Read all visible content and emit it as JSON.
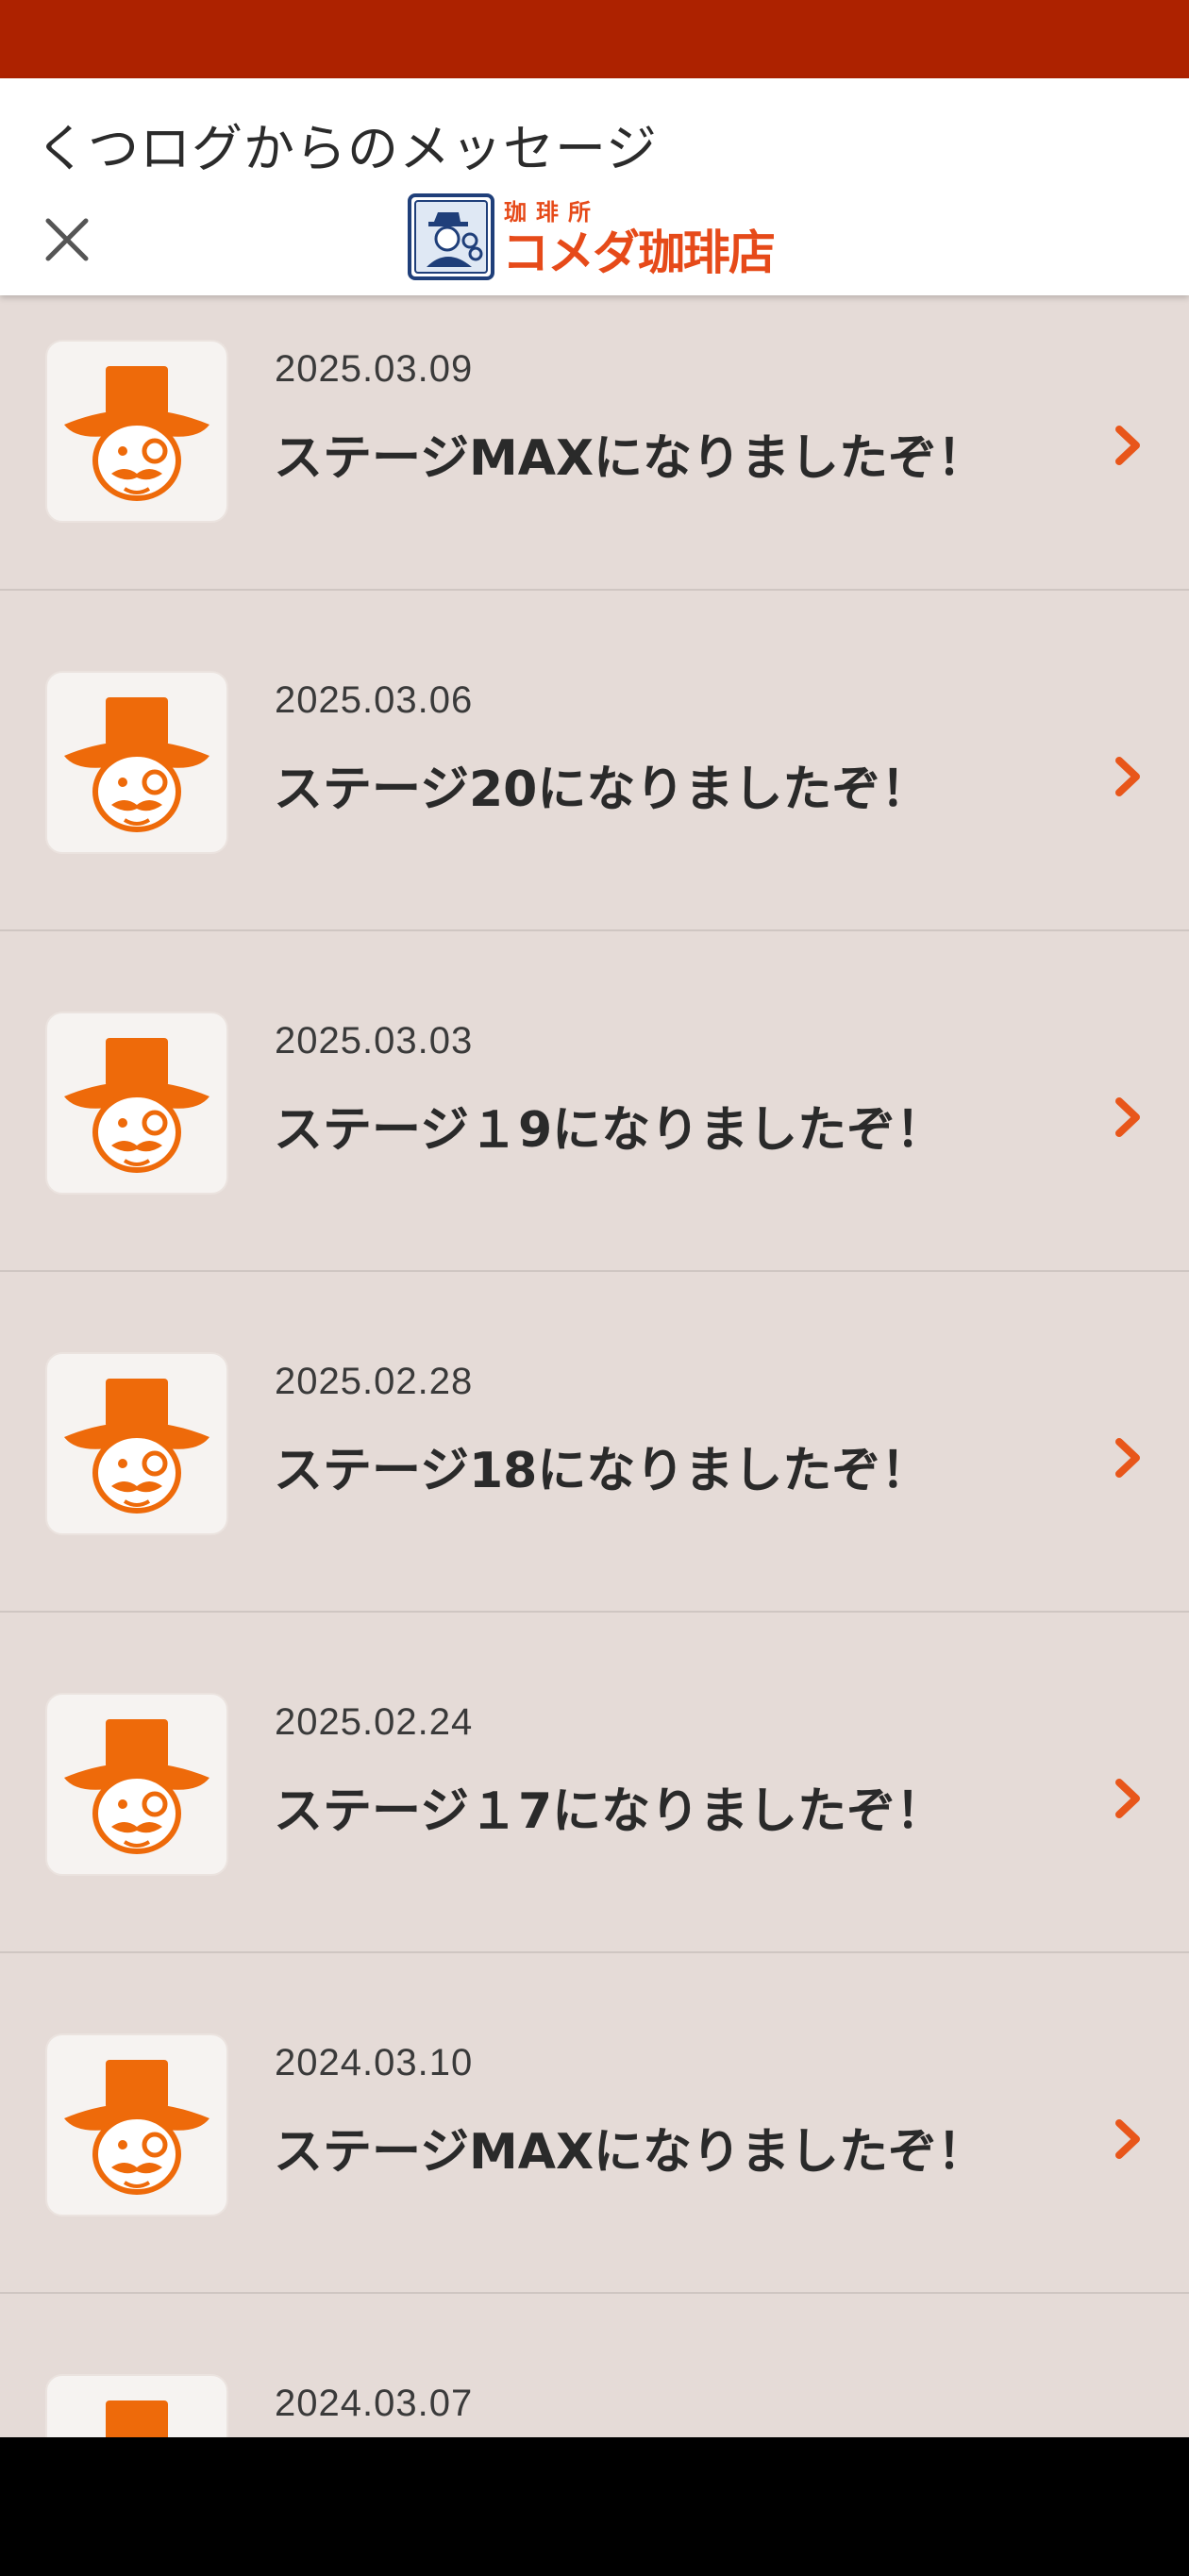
{
  "header": {
    "title": "くつログからのメッセージ",
    "close_icon": "close-icon",
    "logo": {
      "label": "珈琲所 コメダ珈琲店",
      "small_text": "珈琲所",
      "main_text": "コメダ珈琲店",
      "accent_color": "#e64a19"
    }
  },
  "colors": {
    "status_bar": "#ad2200",
    "list_background": "#e5dbd7",
    "accent": "#e8561a"
  },
  "messages": [
    {
      "date": "2025.03.09",
      "text": "ステージMAXになりましたぞ！",
      "icon": "mascot-icon"
    },
    {
      "date": "2025.03.06",
      "text": "ステージ20になりましたぞ！",
      "icon": "mascot-icon"
    },
    {
      "date": "2025.03.03",
      "text": "ステージ１9になりましたぞ！",
      "icon": "mascot-icon"
    },
    {
      "date": "2025.02.28",
      "text": "ステージ18になりましたぞ！",
      "icon": "mascot-icon"
    },
    {
      "date": "2025.02.24",
      "text": "ステージ１7になりましたぞ！",
      "icon": "mascot-icon"
    },
    {
      "date": "2024.03.10",
      "text": "ステージMAXになりましたぞ！",
      "icon": "mascot-icon"
    },
    {
      "date": "2024.03.07",
      "text": "",
      "icon": "mascot-icon"
    }
  ]
}
